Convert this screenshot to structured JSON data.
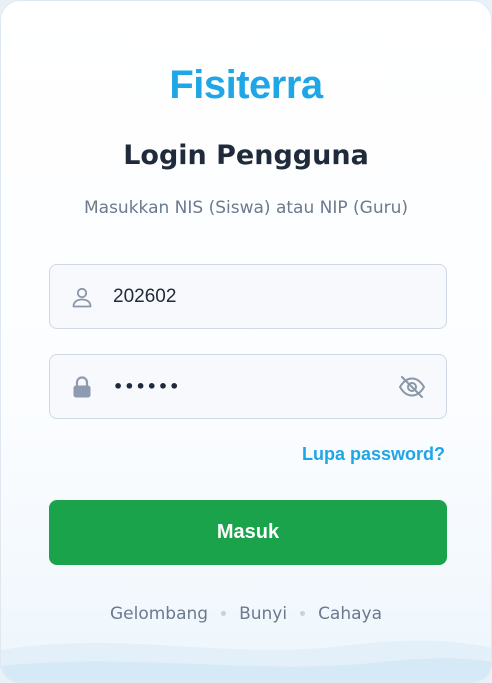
{
  "brand": {
    "name": "Fisiterra",
    "color": "#1fa6e6"
  },
  "login": {
    "title": "Login Pengguna",
    "subtitle": "Masukkan NIS (Siswa) atau NIP (Guru)",
    "username": {
      "value": "202602",
      "icon": "user-icon"
    },
    "password": {
      "value": "••••••",
      "icon": "lock-icon",
      "toggle_icon": "eye-off-icon"
    },
    "forgot_label": "Lupa password?",
    "submit_label": "Masuk",
    "submit_color": "#1aa34a"
  },
  "topics": [
    "Gelombang",
    "Bunyi",
    "Cahaya"
  ]
}
